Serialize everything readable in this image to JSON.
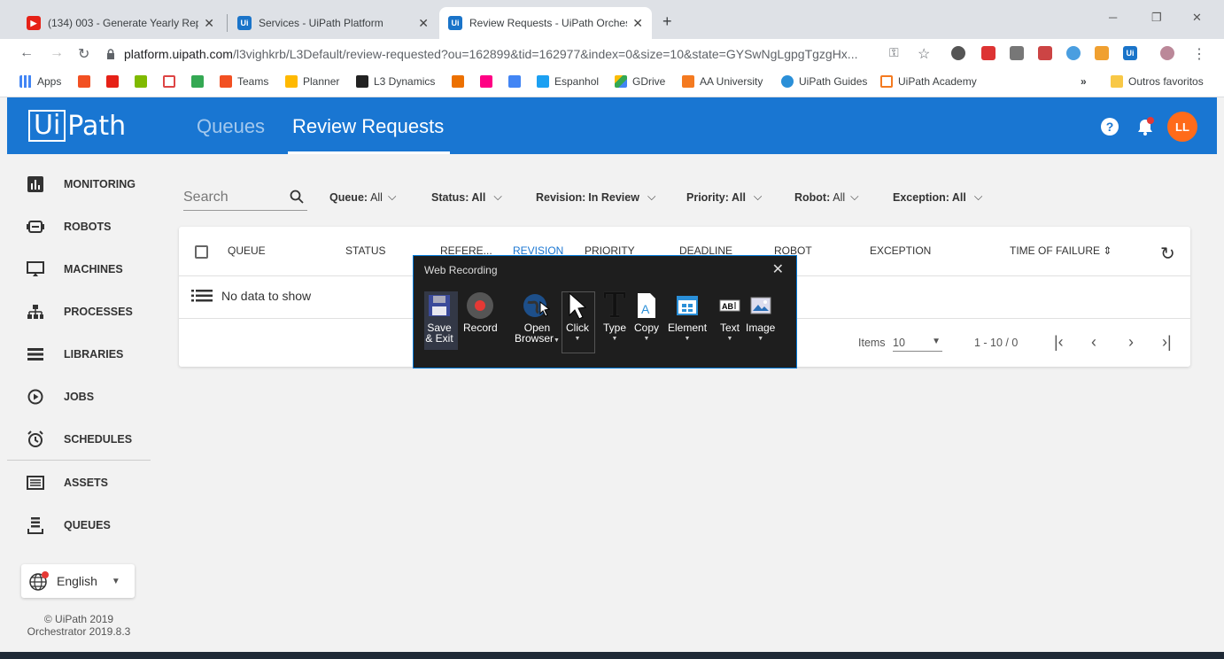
{
  "browser": {
    "tabs": [
      {
        "title": "(134) 003 - Generate Yearly Repo",
        "favicon": "youtube-icon"
      },
      {
        "title": "Services - UiPath Platform",
        "favicon": "uipath-icon"
      },
      {
        "title": "Review Requests - UiPath Orches",
        "favicon": "uipath-icon"
      }
    ],
    "new_tab": "+",
    "url_host": "platform.uipath.com",
    "url_path": "/l3vighkrb/L3Default/review-requested?ou=162899&tid=162977&index=0&size=10&state=GYSwNgLgpgTgzgHx...",
    "bookmarks": [
      "Apps",
      "Teams",
      "Planner",
      "L3 Dynamics",
      "Espanhol",
      "GDrive",
      "AA University",
      "UiPath Guides",
      "UiPath Academy"
    ],
    "more_bookmarks": "»",
    "other_bookmarks": "Outros favoritos"
  },
  "header": {
    "logo_box": "Ui",
    "logo_text": "Path",
    "tabs": [
      "Queues",
      "Review Requests"
    ],
    "help": "?",
    "avatar": "LL",
    "accent": "#1976d2"
  },
  "sidebar": {
    "items": [
      {
        "label": "MONITORING",
        "icon": "bar-chart-icon"
      },
      {
        "label": "ROBOTS",
        "icon": "robot-icon"
      },
      {
        "label": "MACHINES",
        "icon": "monitor-icon"
      },
      {
        "label": "PROCESSES",
        "icon": "hierarchy-icon"
      },
      {
        "label": "LIBRARIES",
        "icon": "library-icon"
      },
      {
        "label": "JOBS",
        "icon": "play-circle-icon"
      },
      {
        "label": "SCHEDULES",
        "icon": "alarm-clock-icon"
      },
      {
        "label": "ASSETS",
        "icon": "assets-icon"
      },
      {
        "label": "QUEUES",
        "icon": "queue-icon"
      }
    ],
    "language": "English",
    "copyright": "© UiPath 2019",
    "version": "Orchestrator 2019.8.3"
  },
  "filters": {
    "search_placeholder": "Search",
    "items": [
      {
        "name": "Queue:",
        "value": "All"
      },
      {
        "name": "Status:",
        "value": "All"
      },
      {
        "name": "Revision:",
        "value": "In Review"
      },
      {
        "name": "Priority:",
        "value": "All"
      },
      {
        "name": "Robot:",
        "value": "All"
      },
      {
        "name": "Exception:",
        "value": "All"
      }
    ]
  },
  "table": {
    "columns": [
      "QUEUE",
      "STATUS",
      "REFERE...",
      "REVISION",
      "PRIORITY",
      "DEADLINE",
      "ROBOT",
      "EXCEPTION",
      "TIME OF FAILURE"
    ],
    "empty_message": "No data to show",
    "items_label": "Items",
    "items_per_page": "10",
    "range": "1 - 10 / 0"
  },
  "web_recording": {
    "title": "Web Recording",
    "buttons": [
      {
        "label1": "Save",
        "label2": "& Exit"
      },
      {
        "label1": "Record",
        "label2": ""
      },
      {
        "label1": "Open",
        "label2": "Browser"
      },
      {
        "label1": "Click",
        "label2": ""
      },
      {
        "label1": "Type",
        "label2": ""
      },
      {
        "label1": "Copy",
        "label2": ""
      },
      {
        "label1": "Element",
        "label2": ""
      },
      {
        "label1": "Text",
        "label2": ""
      },
      {
        "label1": "Image",
        "label2": ""
      }
    ]
  }
}
